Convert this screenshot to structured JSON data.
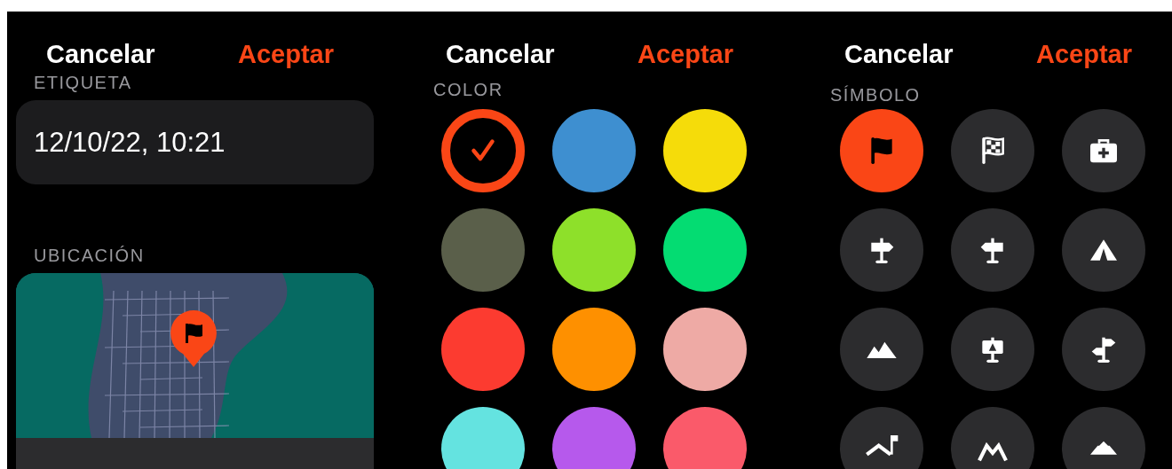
{
  "panels": [
    {
      "kind": "details",
      "cancel": "Cancelar",
      "accept": "Aceptar",
      "sections": [
        {
          "label": "ETIQUETA",
          "kind": "field",
          "value": "12/10/22, 10:21"
        },
        {
          "label": "UBICACIÓN",
          "kind": "map"
        }
      ]
    },
    {
      "kind": "colors",
      "cancel": "Cancelar",
      "accept": "Aceptar",
      "label": "COLOR",
      "colors": [
        {
          "color": "#fa4616",
          "selected": true
        },
        {
          "color": "#3e8fd0",
          "selected": false
        },
        {
          "color": "#f5dc0a",
          "selected": false
        },
        {
          "color": "#5a5f4a",
          "selected": false
        },
        {
          "color": "#8ee02a",
          "selected": false
        },
        {
          "color": "#04dc72",
          "selected": false
        },
        {
          "color": "#fc3b30",
          "selected": false
        },
        {
          "color": "#fe9000",
          "selected": false
        },
        {
          "color": "#eeaaa5",
          "selected": false
        },
        {
          "color": "#64e3e0",
          "selected": false
        },
        {
          "color": "#b659ec",
          "selected": false
        },
        {
          "color": "#fa5a6a",
          "selected": false
        }
      ]
    },
    {
      "kind": "symbols",
      "cancel": "Cancelar",
      "accept": "Aceptar",
      "label": "SÍMBOLO",
      "symbols": [
        {
          "kind": "flag",
          "selected": true
        },
        {
          "kind": "checkered",
          "selected": false
        },
        {
          "kind": "firstaid",
          "selected": false
        },
        {
          "kind": "signright",
          "selected": false
        },
        {
          "kind": "signleft",
          "selected": false
        },
        {
          "kind": "tent",
          "selected": false
        },
        {
          "kind": "mountains",
          "selected": false
        },
        {
          "kind": "board",
          "selected": false
        },
        {
          "kind": "signboth",
          "selected": false
        },
        {
          "kind": "lodge",
          "selected": false
        },
        {
          "kind": "peaks",
          "selected": false
        },
        {
          "kind": "dome",
          "selected": false
        }
      ]
    }
  ]
}
